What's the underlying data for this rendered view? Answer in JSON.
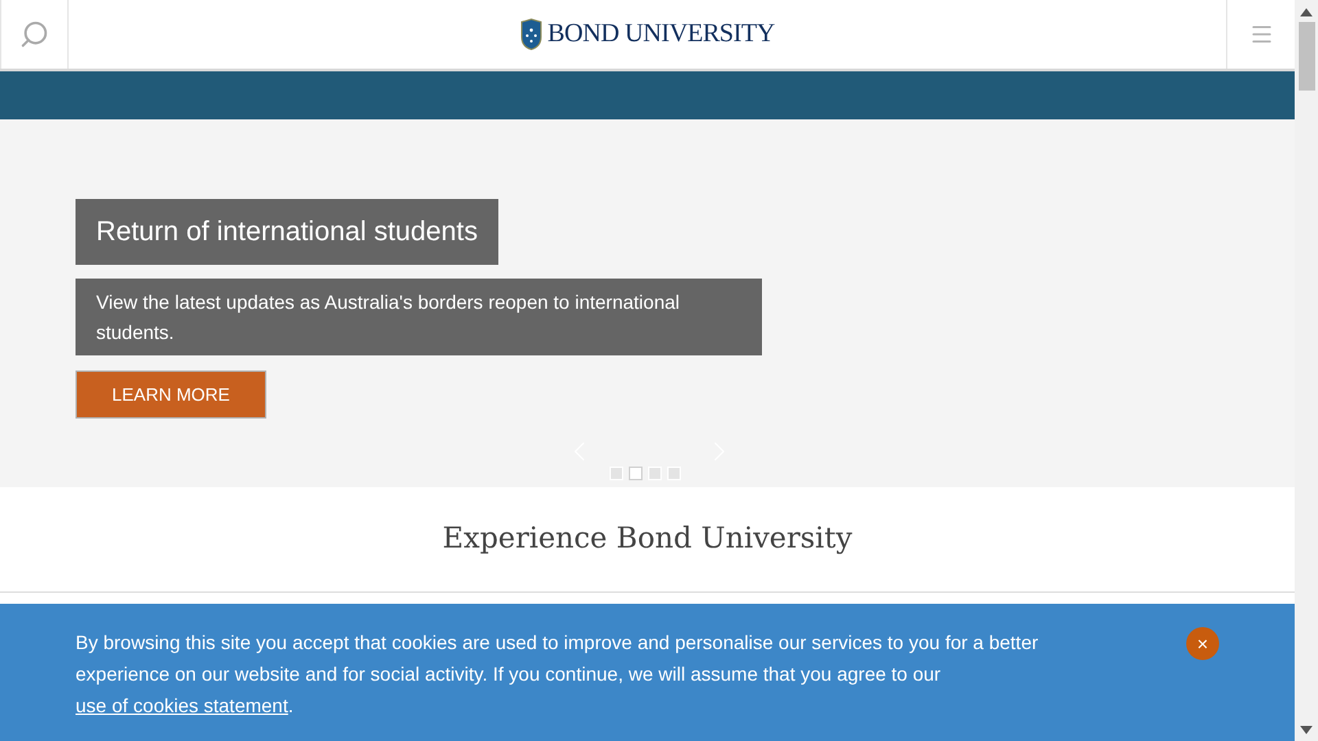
{
  "header": {
    "logo_text": "BOND UNIVERSITY"
  },
  "hero": {
    "title": "Return of international students",
    "description": "View the latest updates as Australia's borders reopen to international students.",
    "button": "LEARN MORE",
    "dots": [
      {
        "selected": false
      },
      {
        "selected": true
      },
      {
        "selected": false
      },
      {
        "selected": false
      }
    ]
  },
  "section": {
    "title": "Experience Bond University"
  },
  "cookie_banner": {
    "text_before": "By browsing this site you accept that cookies are used to improve and personalise our services to you for a better experience on our website and for social activity. If you continue, we will assume that you agree to our",
    "link": "use of cookies statement",
    "text_after": ".",
    "close": "×"
  }
}
